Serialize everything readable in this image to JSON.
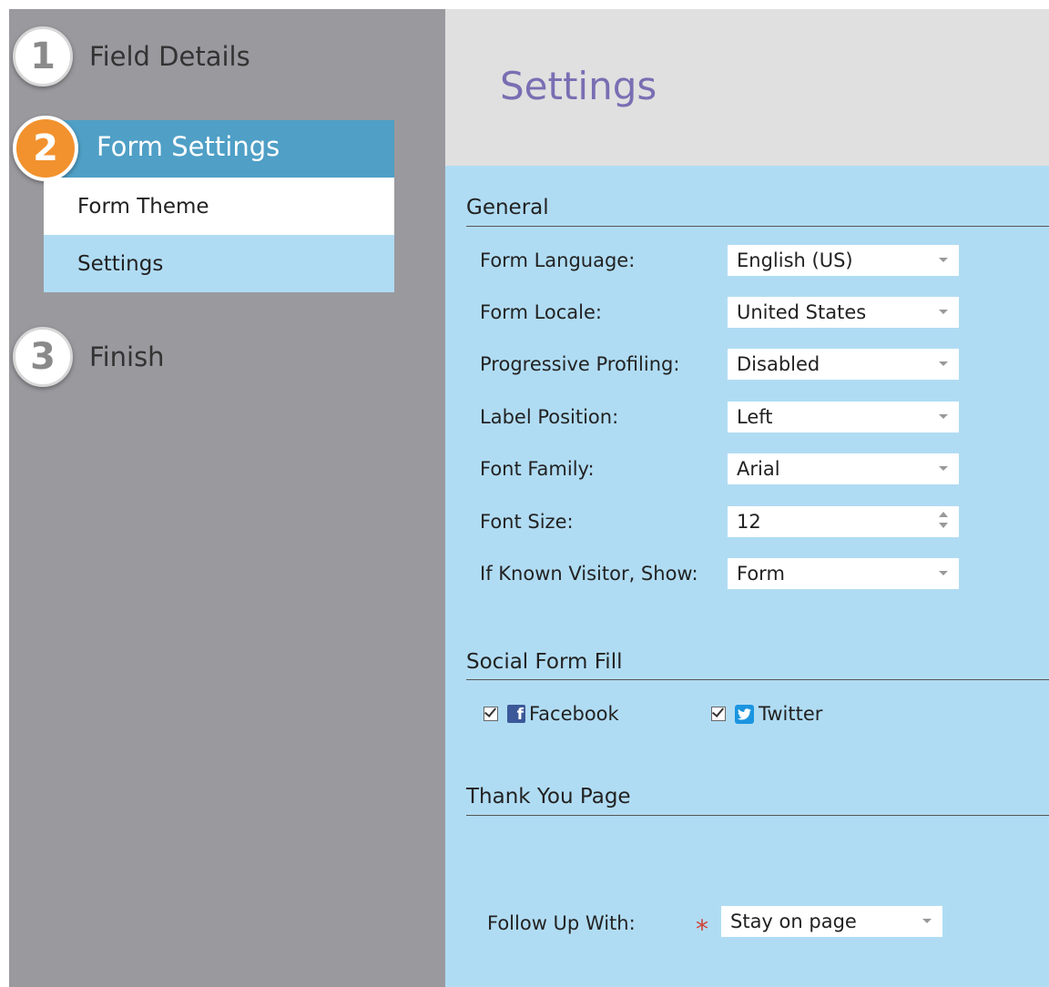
{
  "sidebar": {
    "steps": [
      {
        "number": "1",
        "label": "Field Details"
      },
      {
        "number": "2",
        "label": "Form Settings",
        "substeps": [
          "Form Theme",
          "Settings"
        ]
      },
      {
        "number": "3",
        "label": "Finish"
      }
    ]
  },
  "header": {
    "title": "Settings"
  },
  "general": {
    "title": "General",
    "fields": [
      {
        "label": "Form Language:",
        "value": "English (US)"
      },
      {
        "label": "Form Locale:",
        "value": "United States"
      },
      {
        "label": "Progressive Profiling:",
        "value": "Disabled"
      },
      {
        "label": "Label Position:",
        "value": "Left"
      },
      {
        "label": "Font Family:",
        "value": "Arial"
      },
      {
        "label": "Font Size:",
        "value": "12"
      },
      {
        "label": "If Known Visitor, Show:",
        "value": "Form"
      }
    ]
  },
  "social": {
    "title": "Social Form Fill",
    "facebook": {
      "label": "Facebook",
      "checked": true
    },
    "twitter": {
      "label": "Twitter",
      "checked": true
    }
  },
  "thank_you": {
    "title": "Thank You Page",
    "follow_up_label": "Follow Up With:",
    "required_mark": "*",
    "follow_up_value": "Stay on page"
  },
  "colors": {
    "sidebar_bg": "#9a999e",
    "active_step_bg": "#4f9fc6",
    "active_circle": "#f2922e",
    "panel_bg": "#b0dcf3",
    "title_color": "#7a6eb3"
  }
}
